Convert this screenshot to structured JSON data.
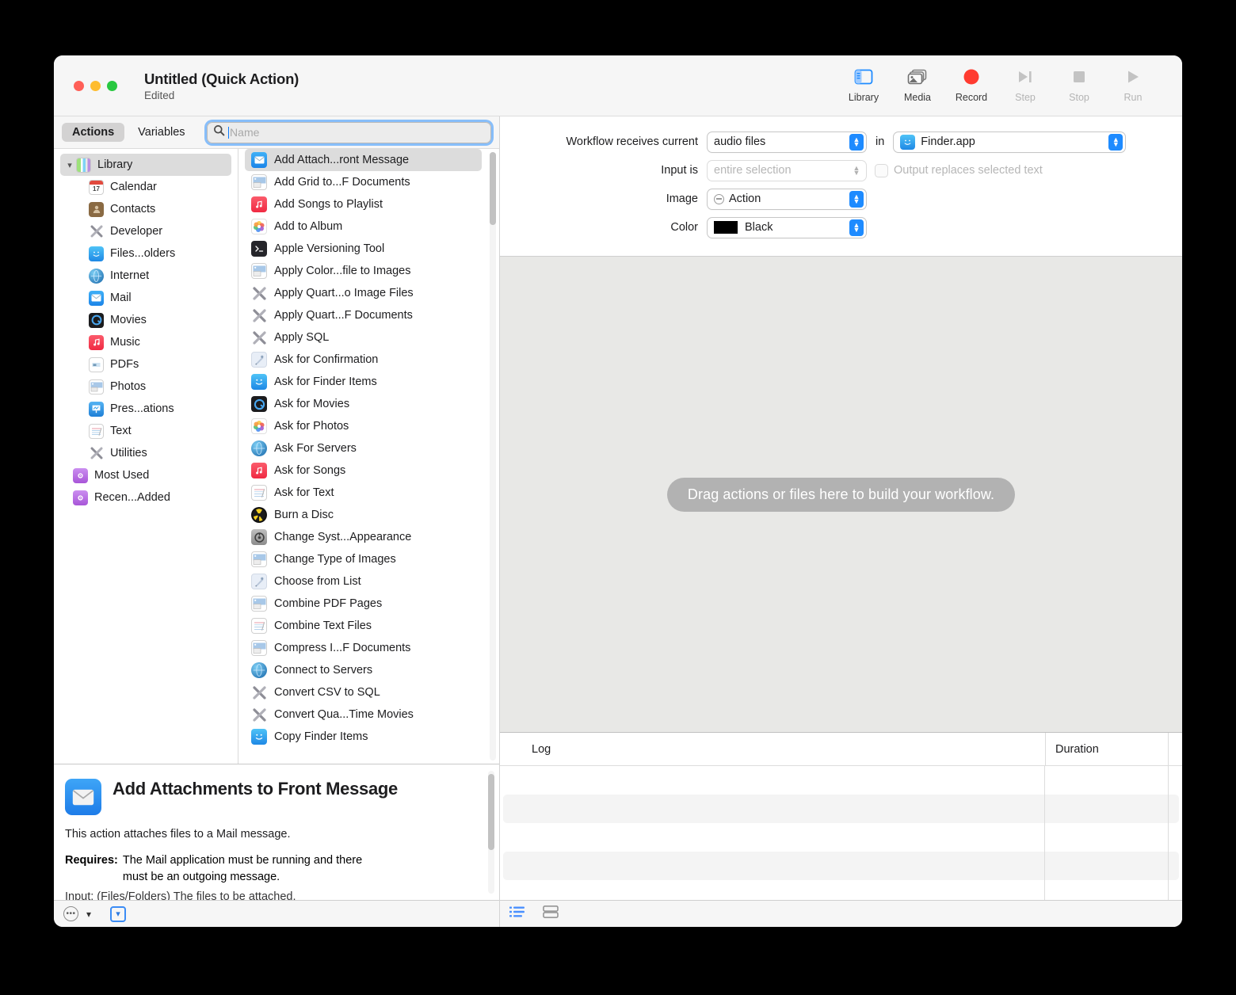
{
  "window": {
    "title": "Untitled (Quick Action)",
    "subtitle": "Edited"
  },
  "toolbar": {
    "items": [
      {
        "label": "Library",
        "icon": "library-icon",
        "state": "active"
      },
      {
        "label": "Media",
        "icon": "media-icon",
        "state": "normal"
      },
      {
        "label": "Record",
        "icon": "record-icon",
        "state": "normal"
      },
      {
        "label": "Step",
        "icon": "step-icon",
        "state": "disabled"
      },
      {
        "label": "Stop",
        "icon": "stop-icon",
        "state": "disabled"
      },
      {
        "label": "Run",
        "icon": "run-icon",
        "state": "disabled"
      }
    ]
  },
  "tabs": {
    "actions": "Actions",
    "variables": "Variables"
  },
  "search": {
    "placeholder": "Name",
    "value": ""
  },
  "sidebar": {
    "root": {
      "label": "Library",
      "icon": "library-books-icon",
      "expanded": true,
      "selected": true
    },
    "items": [
      {
        "label": "Calendar",
        "icon": "calendar-icon"
      },
      {
        "label": "Contacts",
        "icon": "contacts-icon"
      },
      {
        "label": "Developer",
        "icon": "developer-icon"
      },
      {
        "label": "Files...olders",
        "icon": "finder-icon"
      },
      {
        "label": "Internet",
        "icon": "internet-icon"
      },
      {
        "label": "Mail",
        "icon": "mail-icon"
      },
      {
        "label": "Movies",
        "icon": "quicktime-icon"
      },
      {
        "label": "Music",
        "icon": "music-icon"
      },
      {
        "label": "PDFs",
        "icon": "pdf-icon"
      },
      {
        "label": "Photos",
        "icon": "photos-doc-icon"
      },
      {
        "label": "Pres...ations",
        "icon": "keynote-icon"
      },
      {
        "label": "Text",
        "icon": "text-icon"
      },
      {
        "label": "Utilities",
        "icon": "developer-icon"
      }
    ],
    "smart_folders": [
      {
        "label": "Most Used",
        "icon": "smart-folder-icon"
      },
      {
        "label": "Recen...Added",
        "icon": "smart-folder-icon"
      }
    ]
  },
  "actions_list": [
    {
      "label": "Add Attach...ront Message",
      "icon": "mail-icon",
      "selected": true
    },
    {
      "label": "Add Grid to...F Documents",
      "icon": "photos-doc-icon"
    },
    {
      "label": "Add Songs to Playlist",
      "icon": "music-icon"
    },
    {
      "label": "Add to Album",
      "icon": "photos-icon"
    },
    {
      "label": "Apple Versioning Tool",
      "icon": "terminal-icon"
    },
    {
      "label": "Apply Color...file to Images",
      "icon": "photos-doc-icon"
    },
    {
      "label": "Apply Quart...o Image Files",
      "icon": "developer-icon"
    },
    {
      "label": "Apply Quart...F Documents",
      "icon": "developer-icon"
    },
    {
      "label": "Apply SQL",
      "icon": "developer-icon"
    },
    {
      "label": "Ask for Confirmation",
      "icon": "automator-icon"
    },
    {
      "label": "Ask for Finder Items",
      "icon": "finder-icon"
    },
    {
      "label": "Ask for Movies",
      "icon": "quicktime-icon"
    },
    {
      "label": "Ask for Photos",
      "icon": "photos-icon"
    },
    {
      "label": "Ask For Servers",
      "icon": "internet-icon"
    },
    {
      "label": "Ask for Songs",
      "icon": "music-icon"
    },
    {
      "label": "Ask for Text",
      "icon": "text-icon"
    },
    {
      "label": "Burn a Disc",
      "icon": "burn-icon"
    },
    {
      "label": "Change Syst...Appearance",
      "icon": "syspref-icon"
    },
    {
      "label": "Change Type of Images",
      "icon": "photos-doc-icon"
    },
    {
      "label": "Choose from List",
      "icon": "automator-icon"
    },
    {
      "label": "Combine PDF Pages",
      "icon": "photos-doc-icon"
    },
    {
      "label": "Combine Text Files",
      "icon": "text-icon"
    },
    {
      "label": "Compress I...F Documents",
      "icon": "photos-doc-icon"
    },
    {
      "label": "Connect to Servers",
      "icon": "internet-icon"
    },
    {
      "label": "Convert CSV to SQL",
      "icon": "developer-icon"
    },
    {
      "label": "Convert Qua...Time Movies",
      "icon": "developer-icon"
    },
    {
      "label": "Copy Finder Items",
      "icon": "finder-icon"
    }
  ],
  "description": {
    "icon": "mail-icon",
    "title": "Add Attachments to Front Message",
    "body": "This action attaches files to a Mail message.",
    "requires_label": "Requires:",
    "requires_text": "The Mail application must be running and there must be an outgoing message.",
    "clipped_line": "Input: (Files/Folders) The files to be attached."
  },
  "left_bottom_bar": {
    "more_button": "•••",
    "chevron": "⌄",
    "toggle_button": "⌄"
  },
  "settings": {
    "receives_label": "Workflow receives current",
    "receives_value": "audio files",
    "in_label": "in",
    "app_value": "Finder.app",
    "app_icon": "finder-icon",
    "input_label": "Input is",
    "input_value": "entire selection",
    "input_disabled": true,
    "output_checkbox_label": "Output replaces selected text",
    "output_checked": false,
    "image_label": "Image",
    "image_value": "Action",
    "image_icon": "minus-circle-icon",
    "color_label": "Color",
    "color_value": "Black",
    "color_hex": "#000000"
  },
  "canvas": {
    "drop_hint": "Drag actions or files here to build your workflow."
  },
  "log": {
    "columns": {
      "log": "Log",
      "duration": "Duration"
    },
    "rows": [],
    "view_toggles": [
      {
        "name": "list-view-icon",
        "active": true
      },
      {
        "name": "split-view-icon",
        "active": false
      }
    ]
  },
  "colors": {
    "accent": "#1e8bff",
    "record": "#ff3b30",
    "canvas_bg": "#e8e8e6",
    "selection": "#dcdcdc"
  }
}
